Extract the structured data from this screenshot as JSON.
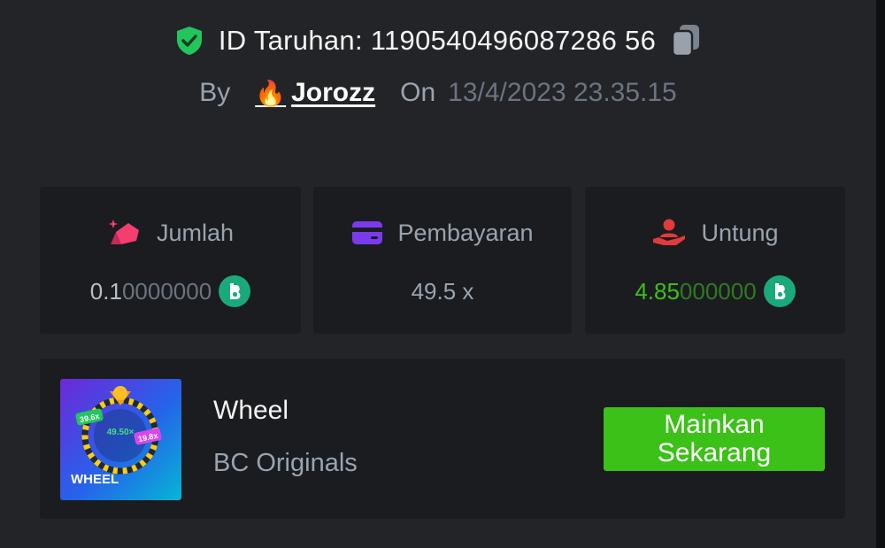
{
  "bet": {
    "id_label": "ID Taruhan:",
    "id_value": "1190540496087286 56"
  },
  "author": {
    "by_label": "By",
    "username": "Jorozz",
    "on_label": "On",
    "datetime": "13/4/2023 23.35.15"
  },
  "stats": [
    {
      "label": "Jumlah",
      "value_main": "0.1",
      "value_faded": "0000000",
      "icon": "amount-bag-icon",
      "currency_icon": "bc-coin-icon"
    },
    {
      "label": "Pembayaran",
      "value": "49.5 x",
      "icon": "card-icon"
    },
    {
      "label": "Untung",
      "value_main": "4.85",
      "value_faded": "000000",
      "icon": "profit-hand-icon",
      "currency_icon": "bc-coin-icon"
    }
  ],
  "game": {
    "name": "Wheel",
    "provider": "BC Originals",
    "play_label": "Mainkan Sekarang",
    "thumb": {
      "title": "WHEEL",
      "center_multiplier": "49.50×",
      "left_multiplier": "39.6x",
      "right_multiplier": "19.8x"
    }
  },
  "colors": {
    "panel_bg": "#232427",
    "card_bg": "#1b1c1f",
    "profit_green": "#3bc117",
    "button_green": "#3bc117",
    "coin_green": "#1aa97a",
    "muted_text": "#99a4b0",
    "shield_green": "#22c55e"
  }
}
